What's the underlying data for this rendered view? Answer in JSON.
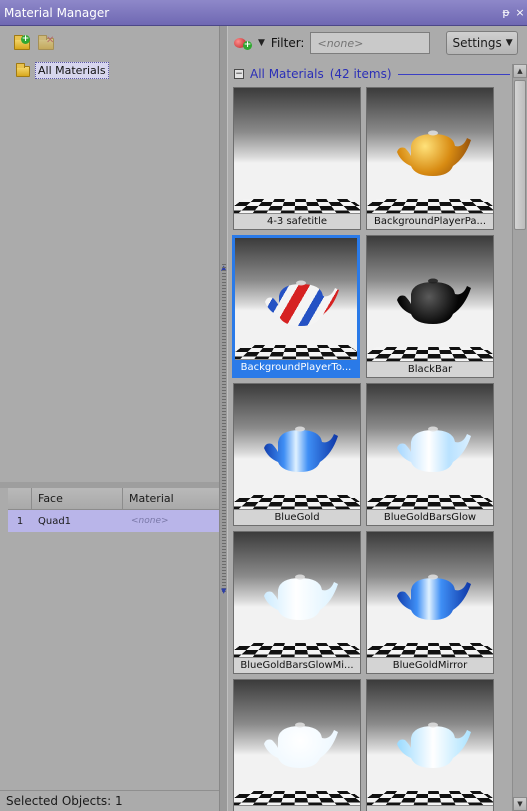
{
  "window": {
    "title": "Material Manager",
    "pin_glyph": "ᵽ",
    "close_glyph": "×"
  },
  "left": {
    "toolbar": [
      {
        "name": "new-folder-icon"
      },
      {
        "name": "delete-folder-icon",
        "disabled": true
      }
    ],
    "tree": [
      {
        "label": "All Materials",
        "selected": true
      }
    ],
    "grid": {
      "columns": [
        "Face",
        "Material"
      ],
      "rows": [
        {
          "num": "1",
          "face": "Quad1",
          "material": "<none>"
        }
      ]
    },
    "status": "Selected Objects: 1"
  },
  "right": {
    "filter_label": "Filter:",
    "filter_placeholder": "<none>",
    "settings_label": "Settings",
    "group": {
      "name": "All Materials",
      "count": "(42 items)"
    },
    "materials": [
      {
        "name": "4-3 safetitle",
        "teapot": "none"
      },
      {
        "name": "BackgroundPlayerPa...",
        "teapot": "fire"
      },
      {
        "name": "BackgroundPlayerTo...",
        "teapot": "flag",
        "selected": true
      },
      {
        "name": "BlackBar",
        "teapot": "black"
      },
      {
        "name": "BlueGold",
        "teapot": "blue"
      },
      {
        "name": "BlueGoldBarsGlow",
        "teapot": "glow"
      },
      {
        "name": "BlueGoldBarsGlowMi...",
        "teapot": "glowfade"
      },
      {
        "name": "BlueGoldMirror",
        "teapot": "blue"
      },
      {
        "name": "",
        "teapot": "white"
      },
      {
        "name": "",
        "teapot": "cyan"
      }
    ]
  },
  "colors": {
    "accent": "#2a7ae8",
    "title_bar": "#7a74bd",
    "group_text": "#2b2fb7",
    "selected_row": "#b9b5e9"
  }
}
